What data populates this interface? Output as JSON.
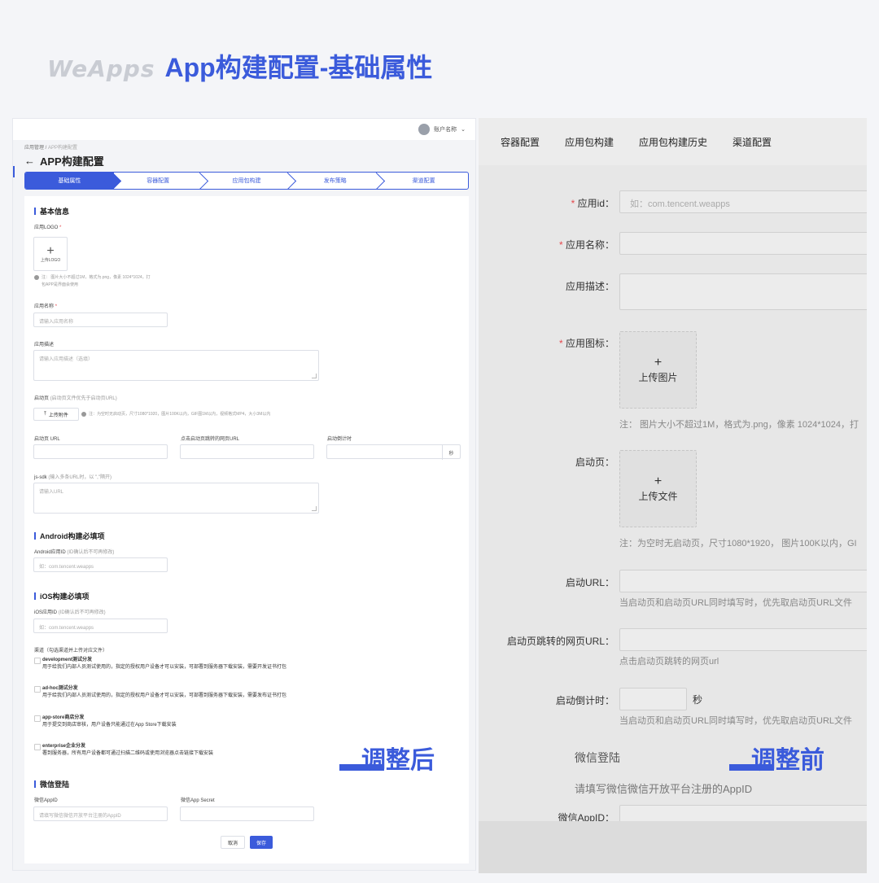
{
  "header": {
    "brand": "WeApps",
    "title": "App构建配置-基础属性"
  },
  "left": {
    "account": "账户名称",
    "breadcrumb": {
      "root": "应用管理 / ",
      "current": "APP构建配置"
    },
    "page_title": "APP构建配置",
    "steps": [
      "基础属性",
      "容器配置",
      "应用包构建",
      "发布策略",
      "渠道配置"
    ],
    "basic": {
      "section": "基本信息",
      "logo_label": "应用LOGO",
      "logo_upload": "上传LOGO",
      "logo_note_1": "注：  图片大小不超过1M，格式为.png，像素 1024*1024，打",
      "logo_note_2": "包APP是界面会使用",
      "name_label": "应用名称",
      "name_placeholder": "请输入应用名称",
      "desc_label": "应用描述",
      "desc_placeholder": "请输入应用描述（选填）",
      "splash_label": "启动页",
      "splash_hint": "(启动页文件优先于启动页URL)",
      "upload_btn": "上传附件",
      "upload_note": "注：为空时无启动页，尺寸1080*1920，图片100K以内，GIF图1M以内，视频格式MP4，大小3M以内",
      "url_label": "启动页 URL",
      "jump_label": "点击启动页跳转的网页URL",
      "countdown_label": "启动倒计时",
      "sec_suffix": "秒",
      "jssdk_label": "js-sdk",
      "jssdk_hint": "(输入多条URL时，以 \",\"隔开)",
      "jssdk_placeholder": "请输入URL"
    },
    "android": {
      "section": "Android构建必填项",
      "id_label": "Android应用ID",
      "id_hint": "(ID确认后不可再修改)",
      "id_placeholder": "如：com.tencent.weapps"
    },
    "ios": {
      "section": "iOS构建必填项",
      "id_label": "iOS应用ID",
      "id_hint": "(ID确认后不可再修改)",
      "id_placeholder": "如：com.tencent.weapps",
      "channel_label": "渠道（勾选渠道并上传对应文件）",
      "channels": [
        {
          "name": "development测试分发",
          "desc": "用于给我们内部人员测试使用的，指定的授权用户设备才可以安装，可部署到服务器下载安装，需要开发证书打包"
        },
        {
          "name": "ad-hoc测试分发",
          "desc": "用于给我们内部人员测试使用的，指定的授权用户设备才可以安装，可部署到服务器下载安装，需要发布证书打包"
        },
        {
          "name": "app-store商店分发",
          "desc": "用于提交到商店审核，用户设备只能通过在App Store下载安装"
        },
        {
          "name": "enterprise企业分发",
          "desc": "署到服务器，所有用户设备都可通过扫描二维码或使用浏览器点击链接下载安装"
        }
      ]
    },
    "wechat": {
      "section": "微信登陆",
      "appid_label": "微信AppID",
      "appid_placeholder": "请填写微信微信开放平台注册的AppID",
      "secret_label": "微信App Secret"
    },
    "buttons": {
      "cancel": "取消",
      "save": "保存"
    },
    "tag": "调整后"
  },
  "right": {
    "tabs": [
      "容器配置",
      "应用包构建",
      "应用包构建历史",
      "渠道配置"
    ],
    "app_id_label": "应用id：",
    "app_id_placeholder": "如：com.tencent.weapps",
    "app_name_label": "应用名称：",
    "app_desc_label": "应用描述：",
    "icon_label": "应用图标：",
    "icon_upload": "上传图片",
    "icon_note": "注：  图片大小不超过1M，格式为.png，像素 1024*1024，打",
    "splash_label": "启动页：",
    "splash_upload": "上传文件",
    "splash_note": "注：为空时无启动页，尺寸1080*1920，  图片100K以内，GI",
    "url_label": "启动URL：",
    "url_note": "当启动页和启动页URL同时填写时，优先取启动页URL文件",
    "jump_label": "启动页跳转的网页URL：",
    "jump_note": "点击启动页跳转的网页url",
    "countdown_label": "启动倒计时：",
    "sec_suffix": "秒",
    "countdown_note": "当启动页和启动页URL同时填写时，优先取启动页URL文件",
    "wechat_title": "微信登陆",
    "wechat_note": "请填写微信微信开放平台注册的AppID",
    "wechat_appid_label": "微信AppID：",
    "tag": "调整前"
  },
  "colors": {
    "accent": "#3b5bdb",
    "required": "#e5484d"
  }
}
